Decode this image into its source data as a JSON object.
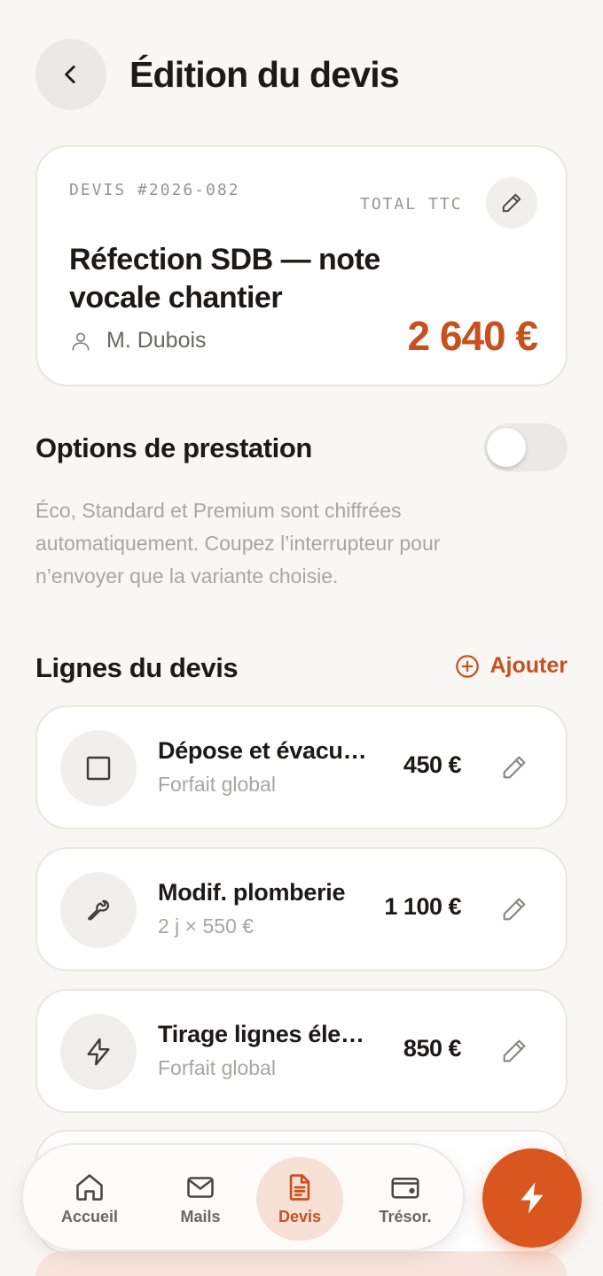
{
  "header": {
    "title": "Édition du devis"
  },
  "quote": {
    "number": "DEVIS #2026-082",
    "total_label": "TOTAL TTC",
    "title": "Réfection SDB — note vocale chantier",
    "client": "M. Dubois",
    "total": "2 640 €"
  },
  "options": {
    "title": "Options de prestation",
    "enabled": false,
    "description": "Éco, Standard et Premium sont chiffrées automatiquement. Coupez l’interrupteur pour n’envoyer que la variante choisie."
  },
  "lines": {
    "title": "Lignes du devis",
    "add_label": "Ajouter",
    "items": [
      {
        "name": "Dépose et évacuation",
        "sub": "Forfait global",
        "price": "450 €",
        "icon": "square-icon"
      },
      {
        "name": "Modif. plomberie",
        "sub": "2 j × 550 €",
        "price": "1 100 €",
        "icon": "wrench-icon"
      },
      {
        "name": "Tirage lignes électriques",
        "sub": "Forfait global",
        "price": "850 €",
        "icon": "lightning-icon"
      }
    ]
  },
  "nav": {
    "items": [
      {
        "label": "Accueil",
        "icon": "home-icon"
      },
      {
        "label": "Mails",
        "icon": "mail-icon"
      },
      {
        "label": "Devis",
        "icon": "document-icon",
        "active": true
      },
      {
        "label": "Trésor.",
        "icon": "wallet-icon"
      }
    ]
  },
  "colors": {
    "accent": "#c8501d",
    "fab": "#d9571e",
    "background": "#f8f7f4"
  }
}
